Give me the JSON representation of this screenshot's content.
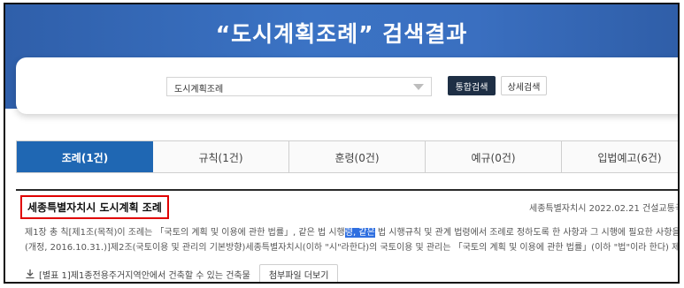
{
  "header": {
    "title": "“도시계획조례” 검색결과"
  },
  "search": {
    "selected_value": "도시계획조례",
    "integrated_button": "통합검색",
    "detail_button": "상세검색"
  },
  "tabs": [
    {
      "label": "조례(1건)",
      "active": true
    },
    {
      "label": "규칙(1건)",
      "active": false
    },
    {
      "label": "훈령(0건)",
      "active": false
    },
    {
      "label": "예규(0건)",
      "active": false
    },
    {
      "label": "입법예고(6건)",
      "active": false
    }
  ],
  "result": {
    "title": "세종특별자치시 도시계획 조례",
    "meta": "세종특별자치시 2022.02.21 건설교통국 도시",
    "line1_a": "제1장 총 칙[제1조(목적)이 조례는 「국토의 계획 및 이용에 관한 법률」, 같은 법 시행",
    "line1_hl": "령, 같은",
    "line1_b": " 법 시행규칙 및 관계 법령에서 조례로 정하도록 한 사항과 그 시행에 필요한 사항을 규정함을 목적으로 한다.",
    "line2": "(개정, 2016.10.31.)]제2조(국토이용 및 관리의 기본방향)세종특별자치시(이하 \"시\"라한다)의 국토이용 및 관리는 「국토의 계획 및 이용에 관한 법률」(이하 \"법\"이라 한다) 제3조의 기본원칙을 바탕으",
    "attachment": "[별표 1]제1종전용주거지역안에서 건축할 수 있는 건축물",
    "attachment_more": "첨부파일 더보기"
  },
  "colors": {
    "banner": "#3b73c4",
    "active_tab": "#1f67b3",
    "dark_button": "#1e2f45",
    "highlight": "#2f6fe0",
    "title_box": "#e00000"
  }
}
